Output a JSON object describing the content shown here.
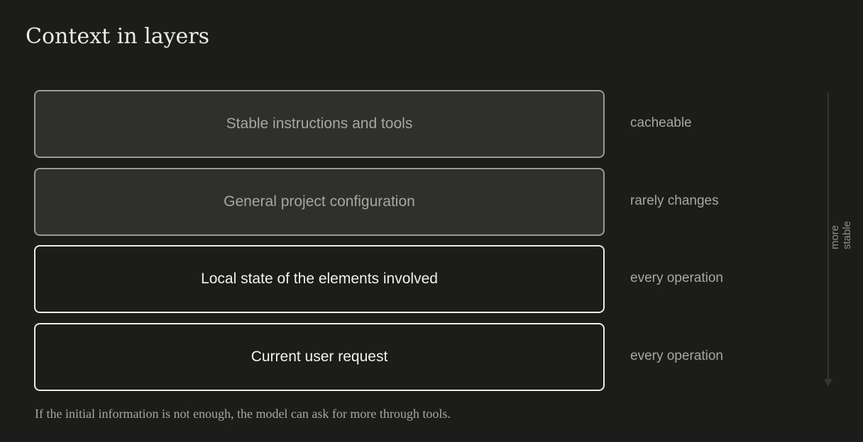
{
  "title": "Context in layers",
  "layers": [
    {
      "label": "Stable instructions and tools",
      "note": "cacheable",
      "emphasis": "muted"
    },
    {
      "label": "General project configuration",
      "note": "rarely changes",
      "emphasis": "muted"
    },
    {
      "label": "Local state of the elements involved",
      "note": "every operation",
      "emphasis": "bright"
    },
    {
      "label": "Current user request",
      "note": "every operation",
      "emphasis": "bright"
    }
  ],
  "axis": {
    "label": "more\nstable",
    "direction": "down"
  },
  "footnote": "If the initial information is not enough, the model can ask for more through tools.",
  "colors": {
    "background": "#1c1c1b",
    "muted_fill": "#2f2f2b",
    "muted_border": "#9b9a91",
    "bright_border": "#ecebe4",
    "text_primary": "#f2f1ea",
    "text_secondary": "#a8a79e"
  }
}
